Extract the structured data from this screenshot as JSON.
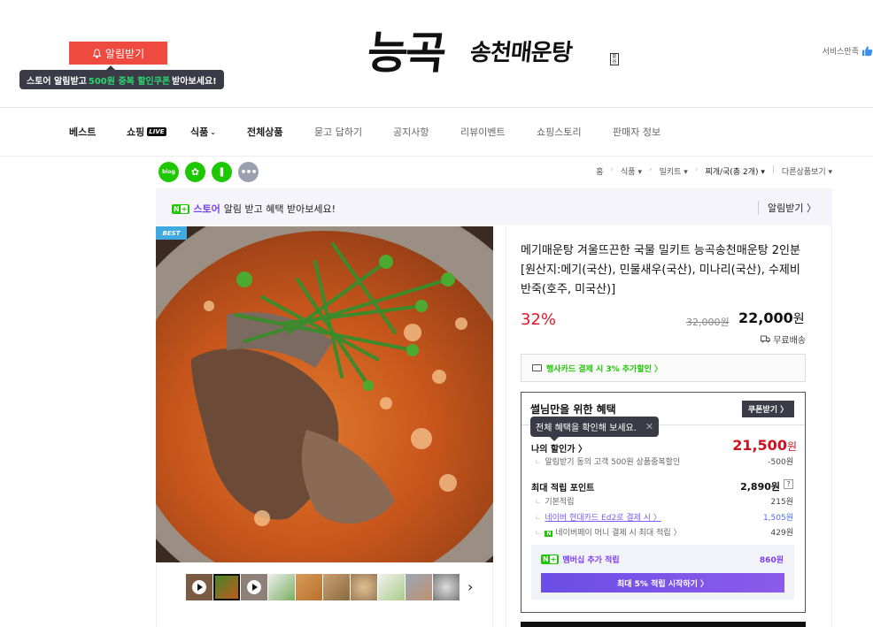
{
  "header": {
    "alarm_button": "알림받기",
    "coupon_tip": {
      "pre": "스토어 알림받고",
      "highlight": "500원 중복 할인쿠폰",
      "post": "받아보세요!"
    },
    "logo": {
      "main": "능곡",
      "sub": "송천매운탕",
      "seal": "能谷"
    },
    "satisfaction": "서비스만족",
    "satisfaction_icon": "thumbs-up-icon",
    "accent_color": "#ef4a3f"
  },
  "nav": {
    "items": [
      {
        "label": "베스트"
      },
      {
        "label": "쇼핑",
        "badge": "LIVE"
      },
      {
        "label": "식품",
        "caret": "⌄"
      },
      {
        "label": "전체상품"
      },
      {
        "label": "묻고 답하기"
      },
      {
        "label": "공지사항"
      },
      {
        "label": "리뷰이벤트"
      },
      {
        "label": "쇼핑스토리"
      },
      {
        "label": "판매자 정보"
      }
    ]
  },
  "share": {
    "icons": [
      {
        "name": "blog-icon",
        "glyph": "blog"
      },
      {
        "name": "talk-icon",
        "glyph": "✿"
      },
      {
        "name": "bookmark-icon",
        "glyph": "❚"
      },
      {
        "name": "more-icon",
        "glyph": "•••"
      }
    ]
  },
  "breadcrumb": [
    "홈",
    "식품",
    "밀키트",
    "찌개/국(총 2개)",
    "다른상품보기"
  ],
  "store_bar": {
    "badge": "N",
    "store_word": "스토어",
    "message": "알림 받고 혜택 받아보세요!",
    "right_link": "알림받기 〉"
  },
  "product": {
    "best_badge": "BEST",
    "title": "메기매운탕 겨울뜨끈한 국물 밀키트 능곡송천매운탕 2인분 [원산지:메기(국산), 민물새우(국산), 미나리(국산), 수제비반죽(호주, 미국산)]",
    "discount_rate": "32%",
    "original_price": "32,000원",
    "sale_price": "22,000",
    "sale_unit": "원",
    "shipping": "무료배송",
    "card_benefit": "행사카드 결제 시 3% 추가할인 〉"
  },
  "benefits": {
    "title": "썰님만을 위한 혜택",
    "coupon_button": "쿠폰받기 〉",
    "tooltip": "전체 혜택을 확인해 보세요.",
    "tooltip_close": "✕",
    "my_discount": {
      "label": "나의 할인가 〉",
      "value": "21,500",
      "unit": "원",
      "sub_label": "알림받기 동의 고객 500원 상품중복할인",
      "sub_value": "-500원"
    },
    "points": {
      "label": "최대 적립 포인트",
      "value": "2,890원",
      "help": "?",
      "rows": [
        {
          "label": "기본적립",
          "value": "215원"
        },
        {
          "label": "네이버 현대카드 Ed2로 결제 시 〉",
          "value": "1,505원"
        },
        {
          "label": "네이버페이 머니 결제 시 최대 적립 〉",
          "value": "429원"
        }
      ]
    },
    "membership": {
      "label": "멤버십 추가 적립",
      "value": "860원",
      "button": "최대 5% 적립 시작하기 〉"
    }
  },
  "thumbnails": [
    {
      "type": "video"
    },
    {
      "type": "image",
      "selected": true
    },
    {
      "type": "video"
    },
    {
      "type": "image"
    },
    {
      "type": "image"
    },
    {
      "type": "image"
    },
    {
      "type": "image"
    },
    {
      "type": "image"
    },
    {
      "type": "image"
    },
    {
      "type": "image"
    }
  ],
  "thumbnail_next": "›"
}
